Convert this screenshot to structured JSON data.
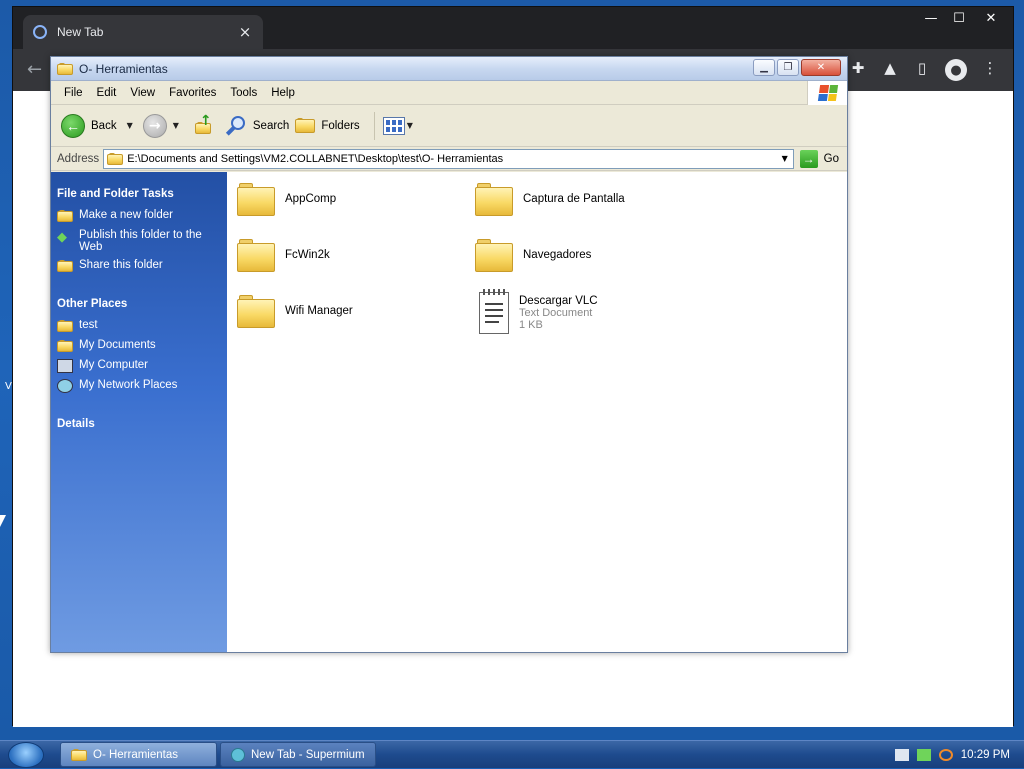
{
  "browser": {
    "tab_title": "New Tab",
    "tab_close": "×",
    "window_controls": {
      "minimize": "—",
      "maximize": "☐",
      "close": "✕"
    },
    "back_glyph": "←",
    "toolbar_icons": [
      "puzzle-icon",
      "flask-icon",
      "sidebar-icon",
      "account-icon",
      "kebab-menu-icon"
    ],
    "edge_text": "V"
  },
  "explorer": {
    "title": "O- Herramientas",
    "controls": {
      "minimize": "▁",
      "maximize": "❐",
      "close": "✕"
    },
    "menu": [
      "File",
      "Edit",
      "View",
      "Favorites",
      "Tools",
      "Help"
    ],
    "toolbar": {
      "back": "Back",
      "search": "Search",
      "folders": "Folders"
    },
    "address": {
      "label": "Address",
      "path": "E:\\Documents and Settings\\VM2.COLLABNET\\Desktop\\test\\O- Herramientas",
      "go": "Go"
    },
    "tasks": {
      "file_folder_header": "File and Folder Tasks",
      "file_folder_items": [
        "Make a new folder",
        "Publish this folder to the Web",
        "Share this folder"
      ],
      "other_places_header": "Other Places",
      "other_places_items": [
        "test",
        "My Documents",
        "My Computer",
        "My Network Places"
      ],
      "details_header": "Details"
    },
    "files": [
      {
        "name": "AppComp",
        "type": "folder"
      },
      {
        "name": "Captura de Pantalla",
        "type": "folder"
      },
      {
        "name": "FcWin2k",
        "type": "folder"
      },
      {
        "name": "Navegadores",
        "type": "folder"
      },
      {
        "name": "Wifi Manager",
        "type": "folder"
      },
      {
        "name": "Descargar VLC",
        "type": "text",
        "kind": "Text Document",
        "size": "1 KB"
      }
    ]
  },
  "taskbar": {
    "items": [
      {
        "label": "O- Herramientas",
        "active": true
      },
      {
        "label": "New Tab - Supermium",
        "active": false
      }
    ],
    "clock": "10:29 PM"
  }
}
